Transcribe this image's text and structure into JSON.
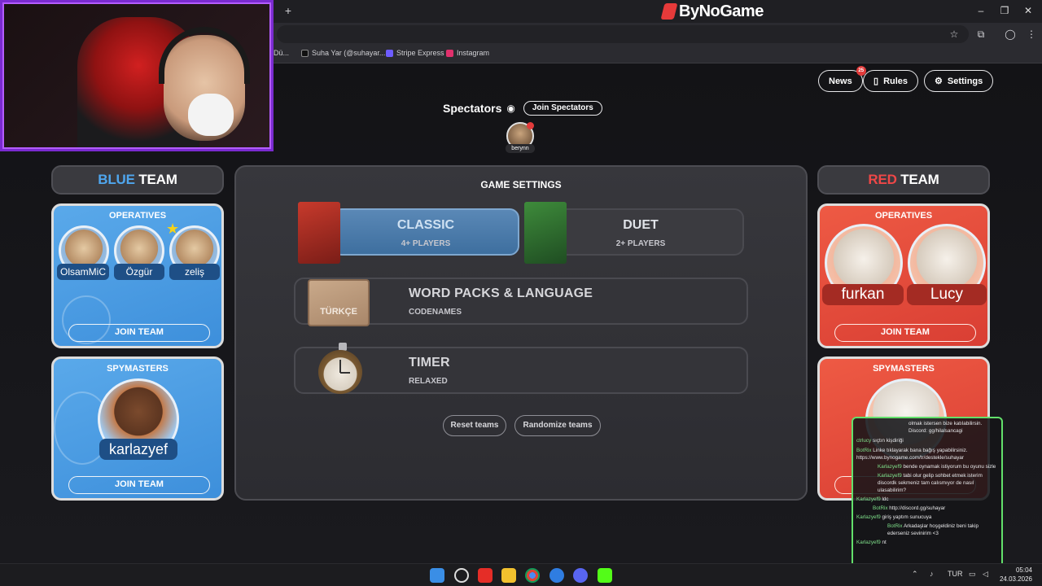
{
  "browser": {
    "new_tab": "+",
    "logo_text": "ByNoGame",
    "bookmarks": [
      "Dü...",
      "Suha Yar (@suhayar....",
      "Stripe Express",
      "Instagram"
    ],
    "window_controls": [
      "–",
      "❐",
      "✕"
    ],
    "address_icons": [
      "☆",
      "⧉",
      "◯",
      "⋮"
    ]
  },
  "header": {
    "news_label": "News",
    "news_count": "25",
    "rules_label": "Rules",
    "settings_label": "Settings"
  },
  "spectators": {
    "title": "Spectators",
    "join_label": "Join Spectators",
    "viewer_name": "berynn"
  },
  "blue_team": {
    "title_color_word": "BLUE",
    "title_word": "TEAM",
    "operatives_title": "OPERATIVES",
    "operatives": [
      "OlsamMiC",
      "Özgür",
      "zeliş"
    ],
    "join_label": "JOIN TEAM",
    "spymasters_title": "SPYMASTERS",
    "spymaster": "karlazyef",
    "spy_join_label": "JOIN TEAM"
  },
  "red_team": {
    "title_color_word": "RED",
    "title_word": "TEAM",
    "operatives_title": "OPERATIVES",
    "operatives": [
      "furkan",
      "Lucy"
    ],
    "join_label": "JOIN TEAM",
    "spymasters_title": "SPYMASTERS"
  },
  "game_settings": {
    "title": "GAME SETTINGS",
    "modes": [
      {
        "name": "CLASSIC",
        "players": "4+ PLAYERS",
        "active": true
      },
      {
        "name": "DUET",
        "players": "2+ PLAYERS",
        "active": false
      }
    ],
    "word_packs": {
      "title": "WORD PACKS & LANGUAGE",
      "value": "CODENAMES",
      "box_label": "TÜRKÇE"
    },
    "timer": {
      "title": "TIMER",
      "value": "RELAXED"
    },
    "reset_label": "Reset teams",
    "randomize_label": "Randomize teams"
  },
  "chat": [
    {
      "user": "",
      "text": "olmak istersen bize katılabilirsin. Discord: gg/hilalsancagi"
    },
    {
      "user": "ctrlucy",
      "text": "sıçtın kişdiriği"
    },
    {
      "user": "BotRix",
      "text": "Linke tıklayarak bana bağış yapabilirsiniz. https://www.bynogame.com/tr/destekle/suhayar"
    },
    {
      "user": "Karlazyef9",
      "text": "bende oynamak istiyorum bu oyunu sizle"
    },
    {
      "user": "Karlazyef9",
      "text": "tabi olur gelip sohbet etmek isterim discordk sekmeniz tam calısmıyor de nasıl ulasabilirim?"
    },
    {
      "user": "Karlazyef9",
      "text": "ldc"
    },
    {
      "user": "BotRix",
      "text": "http://discord.gg/suhayar"
    },
    {
      "user": "Karlazyef9",
      "text": "giriş yaptım sunucuya"
    },
    {
      "user": "BotRix",
      "text": "Arkadaşlar hoşgeldiniz beni takip ederseniz sevinirim <3"
    },
    {
      "user": "Karlazyef9",
      "text": "nt"
    }
  ],
  "taskbar": {
    "lang": "TUR",
    "time": "05:04",
    "date": "24.03.2026"
  },
  "colors": {
    "blue_team": "#3d8fdb",
    "red_team": "#d93e33",
    "accent_purple": "#7a2bd0",
    "chat_border": "#63e06b"
  }
}
